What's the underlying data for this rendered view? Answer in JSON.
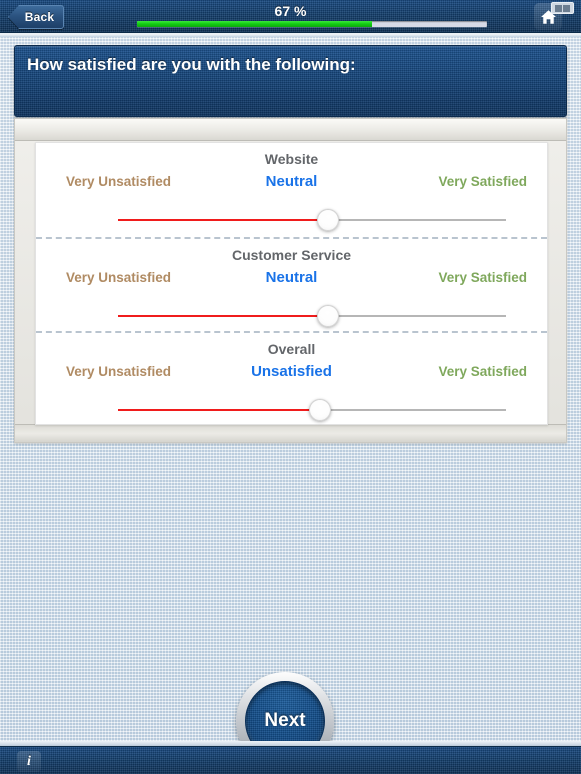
{
  "topbar": {
    "back_label": "Back",
    "percent_label": "67 %",
    "progress_value": 67,
    "home_icon": "home-icon",
    "screens_icon": "screens-icon"
  },
  "question": {
    "text": "How satisfied are you with the following:"
  },
  "scale": {
    "left_label": "Very Unsatisfied",
    "right_label": "Very Satisfied",
    "left_color": "#b08b63",
    "right_color": "#7fa85c",
    "value_color": "#1a73e8",
    "fill_color": "#f01c1c"
  },
  "rows": [
    {
      "title": "Website",
      "value_label": "Neutral",
      "left_label": "Very Unsatisfied",
      "right_label": "Very Satisfied",
      "thumb_percent": 54
    },
    {
      "title": "Customer Service",
      "value_label": "Neutral",
      "left_label": "Very Unsatisfied",
      "right_label": "Very Satisfied",
      "thumb_percent": 54
    },
    {
      "title": "Overall",
      "value_label": "Unsatisfied",
      "left_label": "Very Unsatisfied",
      "right_label": "Very Satisfied",
      "thumb_percent": 52
    }
  ],
  "footer": {
    "next_label": "Next",
    "info_glyph": "i"
  }
}
